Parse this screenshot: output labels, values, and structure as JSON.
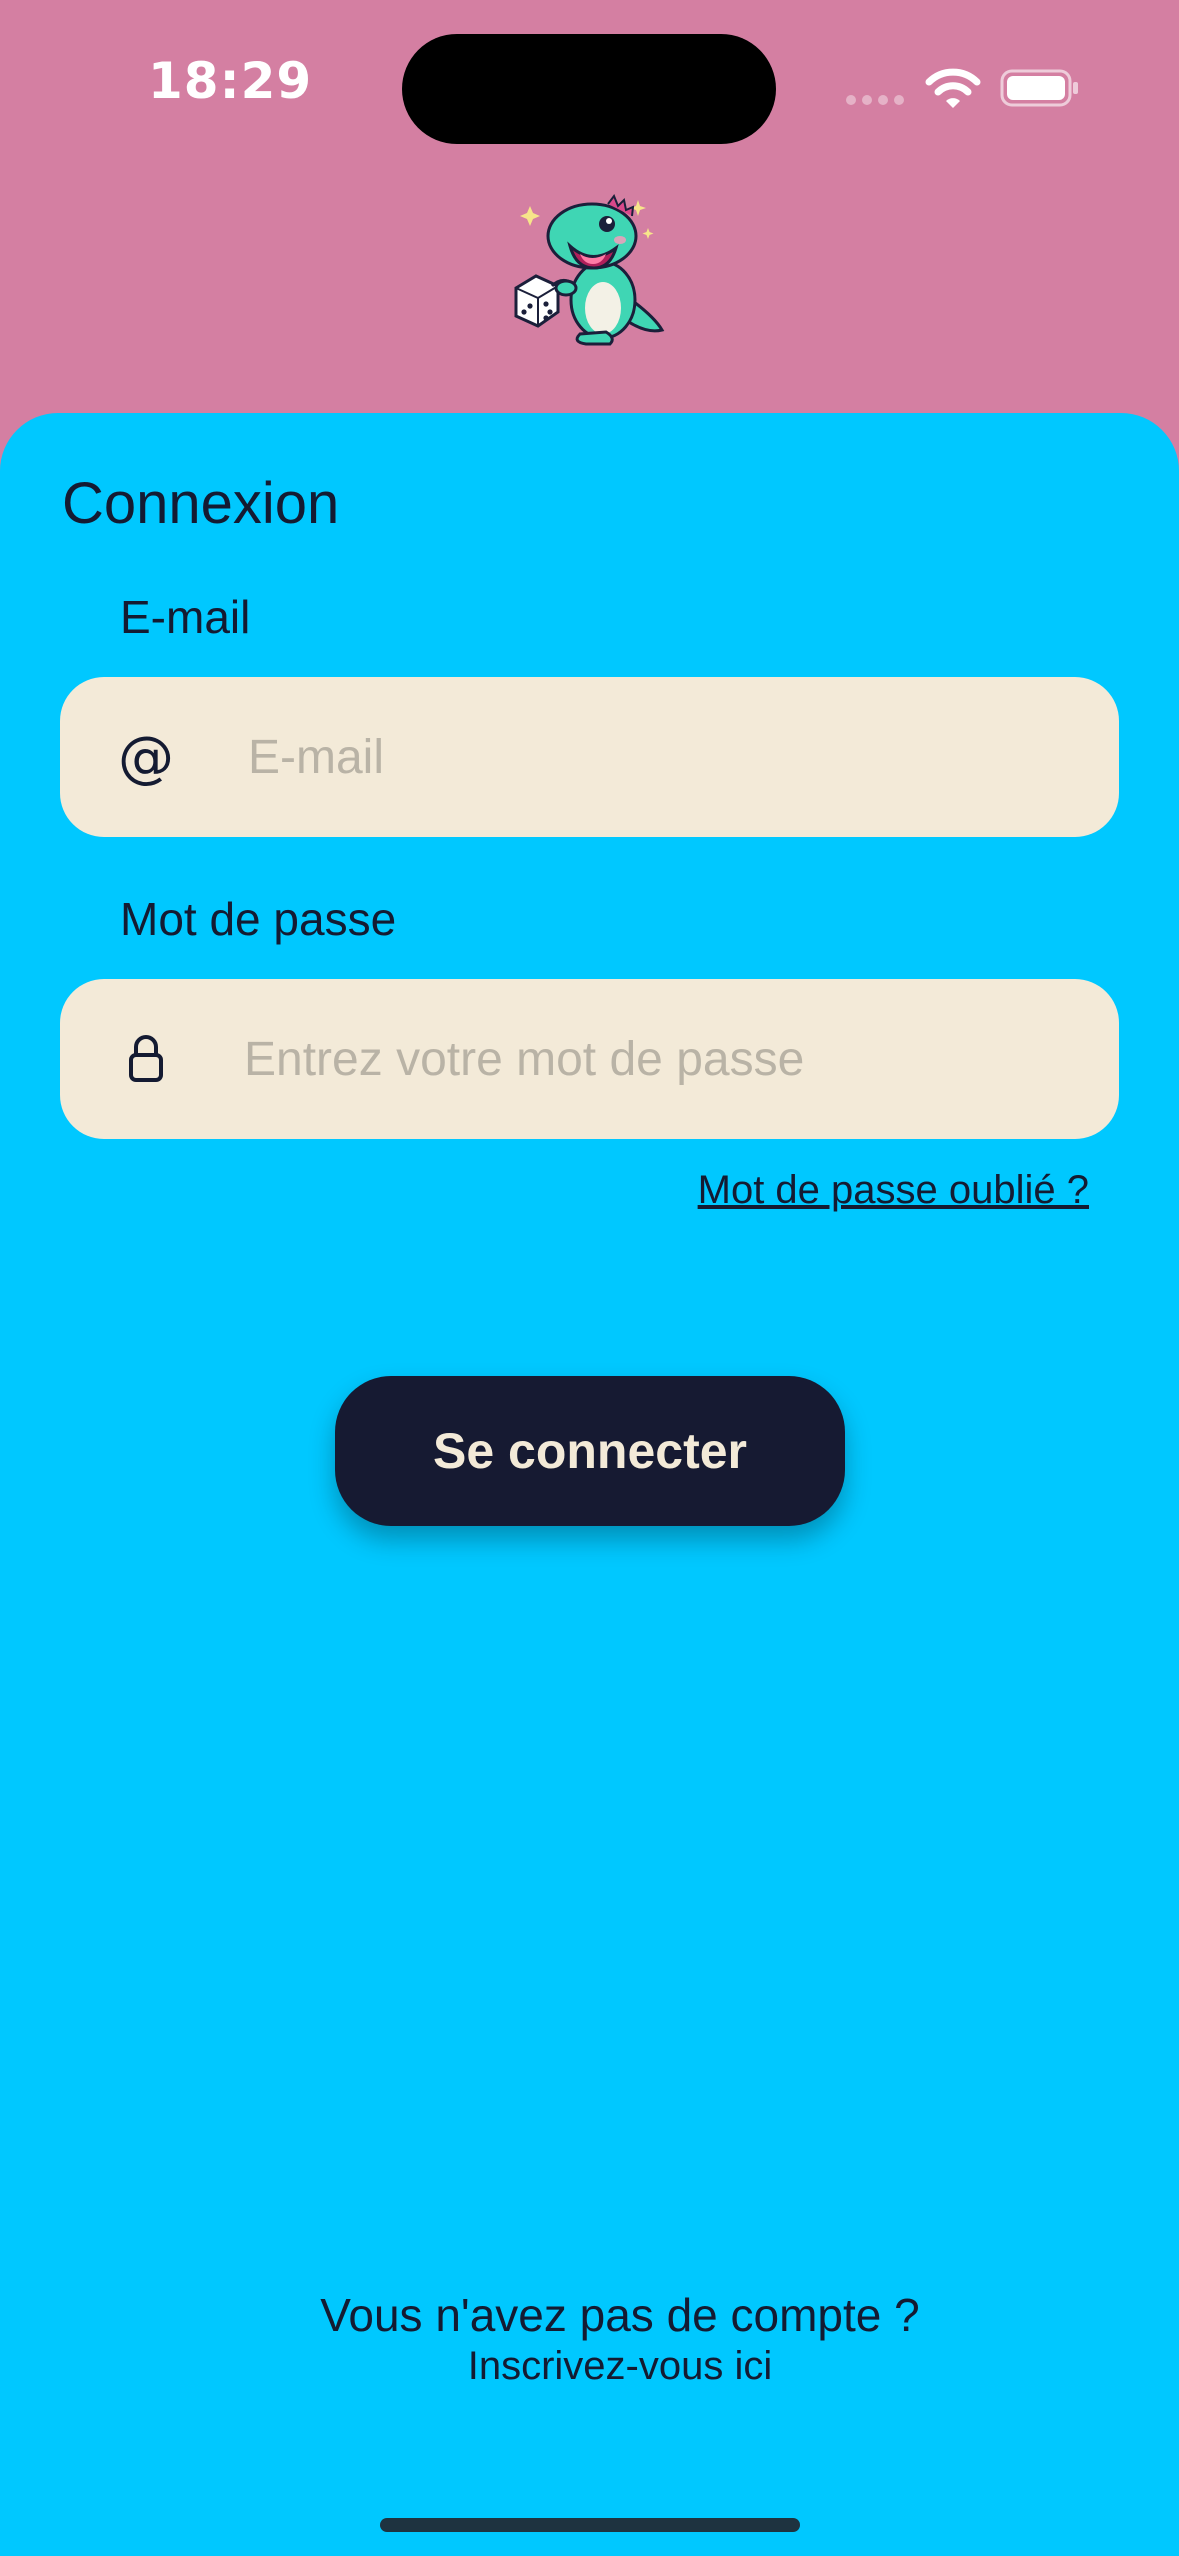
{
  "status_bar": {
    "time": "18:29",
    "icons": [
      "signal-icon",
      "wifi-icon",
      "battery-icon"
    ]
  },
  "mascot": "dinosaur-with-die-icon",
  "login": {
    "title": "Connexion",
    "email": {
      "label": "E-mail",
      "icon": "@",
      "placeholder": "E-mail",
      "value": ""
    },
    "password": {
      "label": "Mot de passe",
      "icon": "lock-icon",
      "placeholder": "Entrez votre mot de passe",
      "value": ""
    },
    "forgot_link": "Mot de passe oublié ?",
    "submit_label": "Se connecter"
  },
  "signup": {
    "prompt": "Vous n'avez pas de compte ?",
    "link": "Inscrivez-vous ici"
  },
  "colors": {
    "header_bg": "#d47fa2",
    "card_bg": "#00c8ff",
    "field_bg": "#f3ead8",
    "button_bg": "#161a32",
    "button_text": "#f3ead8",
    "text": "#141b32"
  }
}
